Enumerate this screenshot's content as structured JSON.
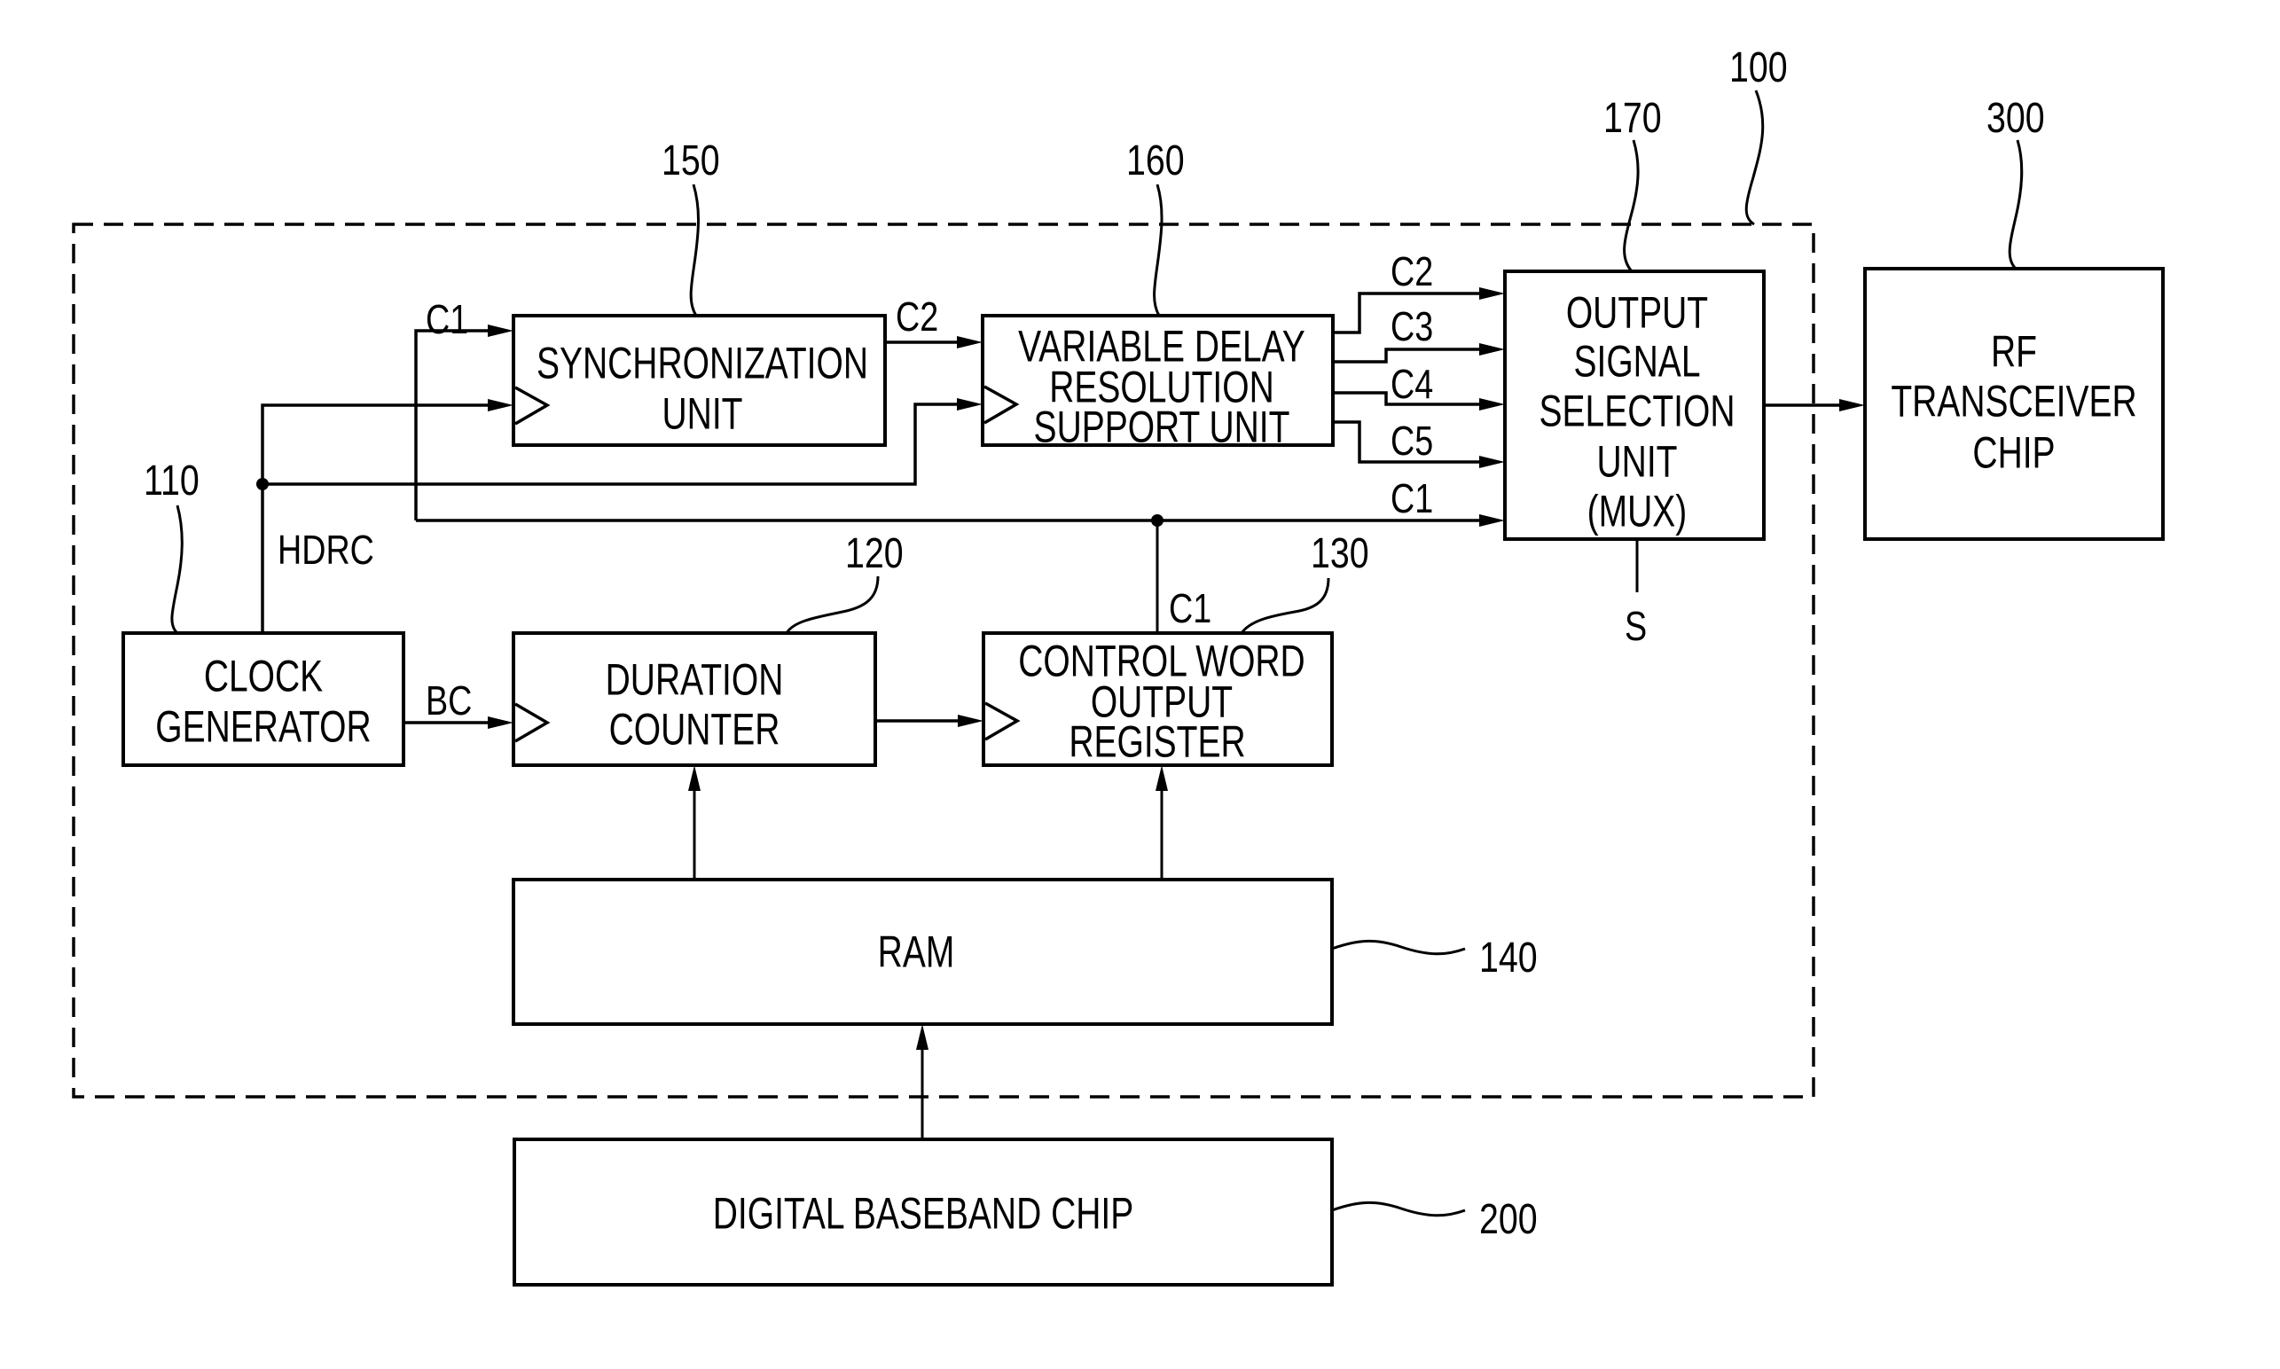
{
  "diagram": {
    "type": "block-diagram",
    "reference_numbers": {
      "system": "100",
      "clock_generator": "110",
      "duration_counter": "120",
      "control_word_register": "130",
      "ram": "140",
      "synchronization_unit": "150",
      "variable_delay_unit": "160",
      "output_selection_unit": "170",
      "digital_baseband_chip": "200",
      "rf_transceiver_chip": "300"
    },
    "blocks": {
      "synchronization_unit": [
        "SYNCHRONIZATION",
        "UNIT"
      ],
      "variable_delay_unit": [
        "VARIABLE DELAY",
        "RESOLUTION",
        "SUPPORT UNIT"
      ],
      "output_selection_unit": [
        "OUTPUT",
        "SIGNAL",
        "SELECTION",
        "UNIT",
        "(MUX)"
      ],
      "rf_transceiver_chip": [
        "RF",
        "TRANSCEIVER",
        "CHIP"
      ],
      "clock_generator": [
        "CLOCK",
        "GENERATOR"
      ],
      "duration_counter": [
        "DURATION",
        "COUNTER"
      ],
      "control_word_register": [
        "CONTROL WORD",
        "OUTPUT",
        "REGISTER"
      ],
      "ram": [
        "RAM"
      ],
      "digital_baseband_chip": [
        "DIGITAL BASEBAND CHIP"
      ]
    },
    "signals": {
      "c1_to_sync": "C1",
      "c2_sync_to_vdr": "C2",
      "hdrc": "HDRC",
      "bc": "BC",
      "mux_c2": "C2",
      "mux_c3": "C3",
      "mux_c4": "C4",
      "mux_c5": "C5",
      "mux_c1": "C1",
      "cwor_c1": "C1",
      "select": "S"
    }
  }
}
